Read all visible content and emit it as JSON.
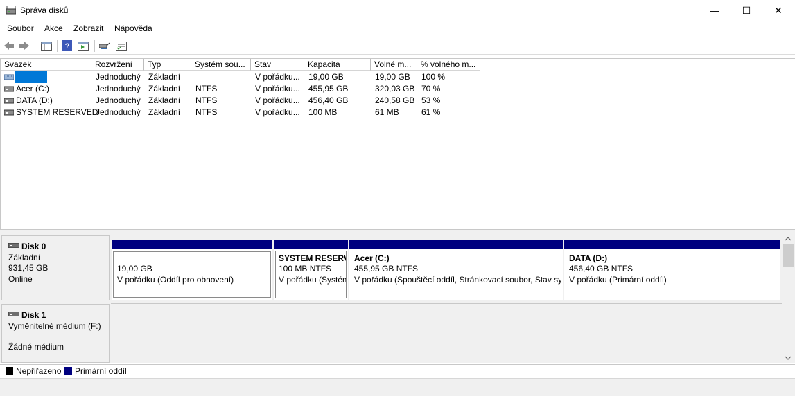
{
  "window": {
    "title": "Správa disků",
    "minimize": "—",
    "maximize": "☐",
    "close": "✕"
  },
  "menu": [
    "Soubor",
    "Akce",
    "Zobrazit",
    "Nápověda"
  ],
  "volume_list": {
    "columns": [
      "Svazek",
      "Rozvržení",
      "Typ",
      "Systém sou...",
      "Stav",
      "Kapacita",
      "Volné m...",
      "% volného m..."
    ],
    "rows": [
      {
        "name": "",
        "layout": "Jednoduchý",
        "type": "Základní",
        "fs": "",
        "status": "V pořádku...",
        "capacity": "19,00 GB",
        "free": "19,00 GB",
        "pct": "100 %"
      },
      {
        "name": "Acer (C:)",
        "layout": "Jednoduchý",
        "type": "Základní",
        "fs": "NTFS",
        "status": "V pořádku...",
        "capacity": "455,95 GB",
        "free": "320,03 GB",
        "pct": "70 %"
      },
      {
        "name": "DATA (D:)",
        "layout": "Jednoduchý",
        "type": "Základní",
        "fs": "NTFS",
        "status": "V pořádku...",
        "capacity": "456,40 GB",
        "free": "240,58 GB",
        "pct": "53 %"
      },
      {
        "name": "SYSTEM RESERVED",
        "layout": "Jednoduchý",
        "type": "Základní",
        "fs": "NTFS",
        "status": "V pořádku...",
        "capacity": "100 MB",
        "free": "61 MB",
        "pct": "61 %"
      }
    ]
  },
  "disk0": {
    "name": "Disk 0",
    "type": "Základní",
    "size": "931,45 GB",
    "state": "Online",
    "partitions": [
      {
        "title": "",
        "size": "19,00 GB",
        "status": "V pořádku (Oddíl pro obnovení)"
      },
      {
        "title": "SYSTEM RESERVE",
        "size": "100 MB NTFS",
        "status": "V pořádku (Systém"
      },
      {
        "title": "Acer  (C:)",
        "size": "455,95 GB NTFS",
        "status": "V pořádku (Spouštěcí oddíl, Stránkovací soubor, Stav sys"
      },
      {
        "title": "DATA  (D:)",
        "size": "456,40 GB NTFS",
        "status": "V pořádku (Primární oddíl)"
      }
    ]
  },
  "disk1": {
    "name": "Disk 1",
    "type": "Vyměnitelné médium (F:)",
    "state": "Žádné médium"
  },
  "legend": {
    "unallocated": "Nepřiřazeno",
    "primary": "Primární oddíl"
  },
  "colors": {
    "primary": "#00007f",
    "unallocated": "#000000",
    "selection": "#0078d7"
  }
}
